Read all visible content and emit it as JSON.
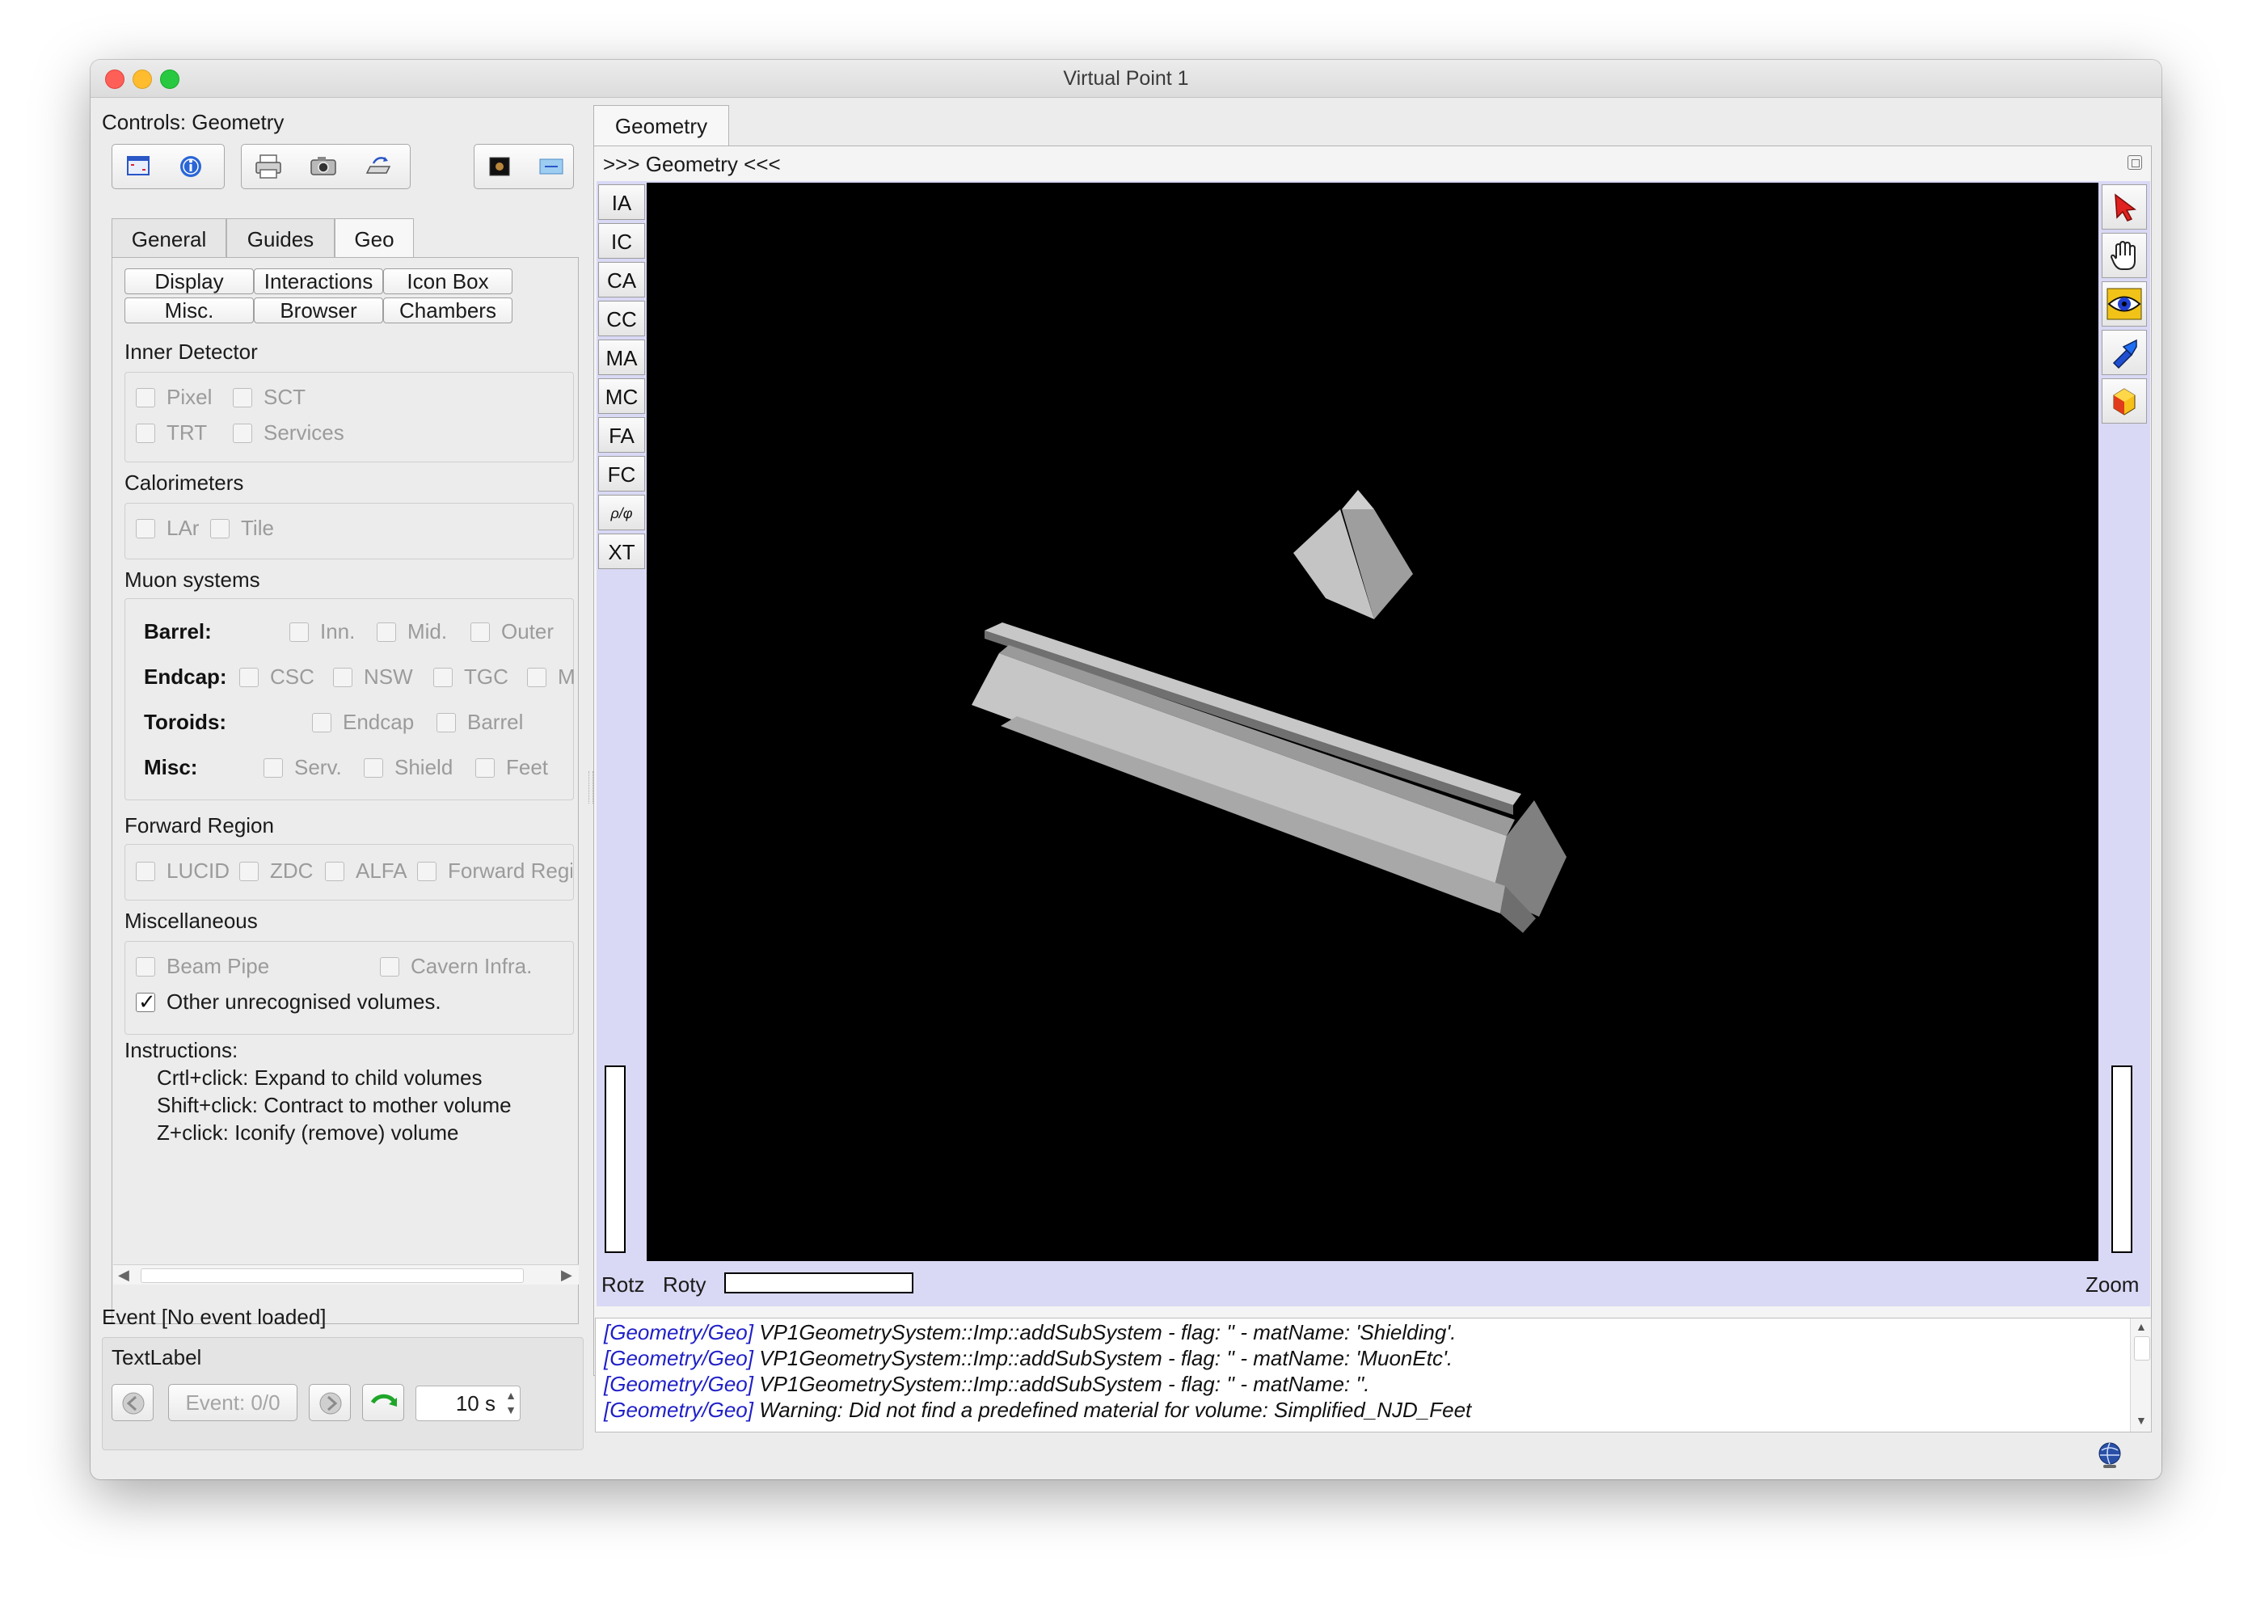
{
  "window": {
    "title": "Virtual Point 1"
  },
  "controls": {
    "title": "Controls: Geometry",
    "toolbar_icons": [
      "fullscreen-icon",
      "info-icon",
      "print-icon",
      "camera-icon",
      "save-icon",
      "dark-view-icon",
      "flat-view-icon"
    ],
    "tabs": [
      {
        "label": "General"
      },
      {
        "label": "Guides"
      },
      {
        "label": "Geo"
      }
    ],
    "active_tab": "Geo",
    "subtabs": [
      {
        "label": "Display"
      },
      {
        "label": "Interactions"
      },
      {
        "label": "Icon Box"
      },
      {
        "label": "Misc."
      },
      {
        "label": "Browser"
      },
      {
        "label": "Chambers"
      }
    ],
    "groups": {
      "inner_detector": {
        "title": "Inner Detector",
        "items": [
          "Pixel",
          "SCT",
          "TRT",
          "Services"
        ]
      },
      "calorimeters": {
        "title": "Calorimeters",
        "items": [
          "LAr",
          "Tile"
        ]
      },
      "muon": {
        "title": "Muon systems",
        "rows": [
          {
            "label": "Barrel:",
            "items": [
              "Inn.",
              "Mid.",
              "Outer"
            ]
          },
          {
            "label": "Endcap:",
            "items": [
              "CSC",
              "NSW",
              "TGC",
              "M"
            ]
          },
          {
            "label": "Toroids:",
            "items": [
              "Endcap",
              "Barrel"
            ]
          },
          {
            "label": "Misc:",
            "items": [
              "Serv.",
              "Shield",
              "Feet"
            ]
          }
        ]
      },
      "forward": {
        "title": "Forward Region",
        "items": [
          "LUCID",
          "ZDC",
          "ALFA",
          "Forward Regi"
        ]
      },
      "misc": {
        "title": "Miscellaneous",
        "items": [
          "Beam Pipe",
          "Cavern Infra."
        ],
        "other": "Other unrecognised volumes.",
        "other_checked": true
      }
    },
    "instructions": {
      "title": "Instructions:",
      "lines": [
        "Crtl+click: Expand to child volumes",
        "Shift+click: Contract to mother volume",
        "Z+click: Iconify (remove) volume"
      ]
    }
  },
  "event": {
    "label": "Event [No event loaded]",
    "text_label": "TextLabel",
    "event_counter": "Event: 0/0",
    "interval": "10 s"
  },
  "viewer": {
    "tab": "Geometry",
    "header": ">>> Geometry <<<",
    "left_buttons": [
      "IA",
      "IC",
      "CA",
      "CC",
      "MA",
      "MC",
      "FA",
      "FC",
      "ρ/φ",
      "XT"
    ],
    "right_icons": [
      "pointer-icon",
      "hand-icon",
      "eye-icon",
      "flashlight-icon",
      "shape-icon"
    ],
    "bottom": {
      "rotz": "Rotz",
      "roty": "Roty",
      "zoom": "Zoom"
    }
  },
  "log": [
    {
      "tag": "[Geometry/Geo]",
      "text": " VP1GeometrySystem::Imp::addSubSystem - flag: '' - matName: 'Shielding'."
    },
    {
      "tag": "[Geometry/Geo]",
      "text": " VP1GeometrySystem::Imp::addSubSystem - flag: '' - matName: 'MuonEtc'."
    },
    {
      "tag": "[Geometry/Geo]",
      "text": " VP1GeometrySystem::Imp::addSubSystem - flag: '' - matName: ''."
    },
    {
      "tag": "[Geometry/Geo]",
      "text": " Warning: Did not find a predefined material for volume: Simplified_NJD_Feet"
    }
  ],
  "colors": {
    "viewer_background": "#000000",
    "viewer_panel": "#d9d9f5",
    "log_tag": "#1f1fc8",
    "shape_light": "#c4c4c4",
    "shape_dark": "#7f7f7f"
  }
}
